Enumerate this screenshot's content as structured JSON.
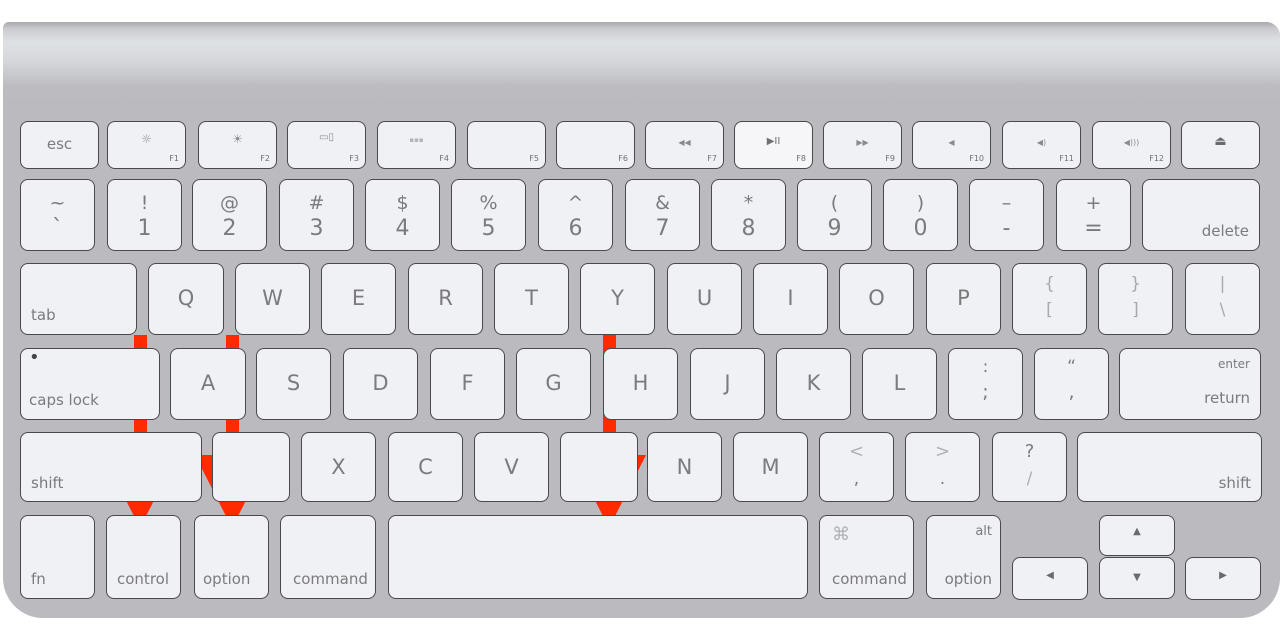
{
  "keyboard": {
    "fn_row": [
      {
        "id": "esc",
        "label": "esc"
      },
      {
        "id": "f1",
        "fn": "F1",
        "icon": "brightness-down-icon",
        "glyph": "☼"
      },
      {
        "id": "f2",
        "fn": "F2",
        "icon": "brightness-up-icon",
        "glyph": "☀"
      },
      {
        "id": "f3",
        "fn": "F3",
        "icon": "mission-control-icon",
        "glyph": "▭▯"
      },
      {
        "id": "f4",
        "fn": "F4",
        "icon": "launchpad-icon",
        "glyph": "▪▪▪"
      },
      {
        "id": "f5",
        "fn": "F5"
      },
      {
        "id": "f6",
        "fn": "F6"
      },
      {
        "id": "f7",
        "fn": "F7",
        "icon": "rewind-icon",
        "glyph": "◀◀"
      },
      {
        "id": "f8",
        "fn": "F8",
        "icon": "play-pause-icon",
        "glyph": "▶II"
      },
      {
        "id": "f9",
        "fn": "F9",
        "icon": "fast-forward-icon",
        "glyph": "▶▶"
      },
      {
        "id": "f10",
        "fn": "F10",
        "icon": "mute-icon",
        "glyph": "◀"
      },
      {
        "id": "f11",
        "fn": "F11",
        "icon": "volume-down-icon",
        "glyph": "◀)"
      },
      {
        "id": "f12",
        "fn": "F12",
        "icon": "volume-up-icon",
        "glyph": "◀)))"
      },
      {
        "id": "eject",
        "icon": "eject-icon",
        "glyph": "⏏"
      }
    ],
    "number_row": [
      {
        "top": "~",
        "bottom": "`"
      },
      {
        "top": "!",
        "bottom": "1"
      },
      {
        "top": "@",
        "bottom": "2"
      },
      {
        "top": "#",
        "bottom": "3"
      },
      {
        "top": "$",
        "bottom": "4"
      },
      {
        "top": "%",
        "bottom": "5"
      },
      {
        "top": "^",
        "bottom": "6"
      },
      {
        "top": "&",
        "bottom": "7"
      },
      {
        "top": "*",
        "bottom": "8"
      },
      {
        "top": "(",
        "bottom": "9"
      },
      {
        "top": ")",
        "bottom": "0"
      },
      {
        "top": "–",
        "bottom": "-"
      },
      {
        "top": "+",
        "bottom": "="
      },
      {
        "label": "delete"
      }
    ],
    "qwerty_row": [
      {
        "label": "tab"
      },
      {
        "label": "Q"
      },
      {
        "label": "W"
      },
      {
        "label": "E"
      },
      {
        "label": "R"
      },
      {
        "label": "T"
      },
      {
        "label": "Y"
      },
      {
        "label": "U"
      },
      {
        "label": "I"
      },
      {
        "label": "O"
      },
      {
        "label": "P"
      },
      {
        "top": "{",
        "bottom": "["
      },
      {
        "top": "}",
        "bottom": "]"
      },
      {
        "top": "|",
        "bottom": "\\"
      }
    ],
    "home_row": [
      {
        "label": "caps lock",
        "indicator": "•"
      },
      {
        "label": "A"
      },
      {
        "label": "S"
      },
      {
        "label": "D"
      },
      {
        "label": "F"
      },
      {
        "label": "G"
      },
      {
        "label": "H"
      },
      {
        "label": "J"
      },
      {
        "label": "K"
      },
      {
        "label": "L"
      },
      {
        "top": ":",
        "bottom": ";"
      },
      {
        "top": "“",
        "bottom": ","
      },
      {
        "top": "enter",
        "bottom": "return"
      }
    ],
    "shift_row": [
      {
        "label": "shift"
      },
      {
        "label": ""
      },
      {
        "label": "X"
      },
      {
        "label": "C"
      },
      {
        "label": "V"
      },
      {
        "label": ""
      },
      {
        "label": "N"
      },
      {
        "label": "M"
      },
      {
        "top": "<",
        "bottom": ","
      },
      {
        "top": ">",
        "bottom": "."
      },
      {
        "top": "?",
        "bottom": "/"
      },
      {
        "label": "shift"
      }
    ],
    "bottom_row": [
      {
        "label": "fn"
      },
      {
        "label": "control"
      },
      {
        "label": "option"
      },
      {
        "label": "command"
      },
      {
        "label": ""
      },
      {
        "top": "⌘",
        "bottom": "command"
      },
      {
        "top": "alt",
        "bottom": "option"
      },
      {
        "label": "◀",
        "icon": "arrow-left-icon"
      },
      {
        "label": "▲",
        "icon": "arrow-up-icon"
      },
      {
        "label": "▼",
        "icon": "arrow-down-icon"
      },
      {
        "label": "▶",
        "icon": "arrow-right-icon"
      }
    ]
  },
  "annotations": {
    "arrow_color": "#ff2a00",
    "arrows": [
      {
        "target": "control"
      },
      {
        "target": "option"
      },
      {
        "target": "space"
      }
    ]
  }
}
